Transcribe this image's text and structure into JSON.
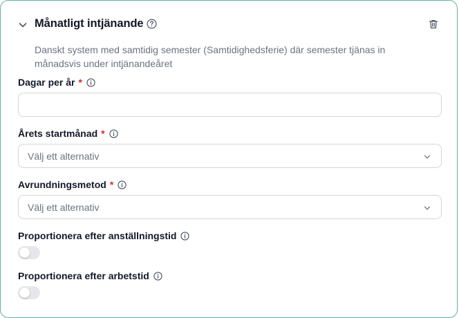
{
  "section": {
    "title": "Månatligt intjänande",
    "description": "Danskt system med samtidig semester (Samtidighedsferie) där semester tjänas in månadsvis under intjänandeåret"
  },
  "fields": {
    "days_per_year": {
      "label": "Dagar per år",
      "required_mark": "*",
      "value": ""
    },
    "start_month": {
      "label": "Årets startmånad",
      "required_mark": "*",
      "placeholder": "Välj ett alternativ"
    },
    "rounding": {
      "label": "Avrundningsmetod",
      "required_mark": "*",
      "placeholder": "Välj ett alternativ"
    },
    "prorate_employment": {
      "label": "Proportionera efter anställningstid",
      "enabled": false
    },
    "prorate_worktime": {
      "label": "Proportionera efter arbetstid",
      "enabled": false
    }
  },
  "colors": {
    "border_accent": "#5fb3a1",
    "required": "#dc2626",
    "muted_text": "#6b7280"
  },
  "icons": {
    "collapse": "chevron-down-icon",
    "help": "question-circle-icon",
    "delete": "trash-icon",
    "info": "info-circle-icon",
    "dropdown": "chevron-down-icon"
  }
}
